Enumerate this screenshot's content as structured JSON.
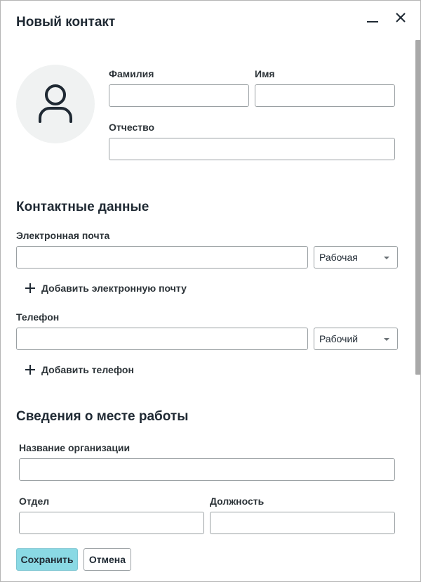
{
  "dialog": {
    "title": "Новый контакт"
  },
  "name": {
    "last_name_label": "Фамилия",
    "first_name_label": "Имя",
    "middle_name_label": "Отчество",
    "last_name_value": "",
    "first_name_value": "",
    "middle_name_value": ""
  },
  "contacts": {
    "section_title": "Контактные данные",
    "email_label": "Электронная почта",
    "email_value": "",
    "email_type": "Рабочая",
    "add_email_label": "Добавить электронную почту",
    "phone_label": "Телефон",
    "phone_value": "",
    "phone_type": "Рабочий",
    "add_phone_label": "Добавить телефон"
  },
  "work": {
    "section_title": "Сведения о месте работы",
    "org_label": "Название организации",
    "org_value": "",
    "department_label": "Отдел",
    "department_value": "",
    "position_label": "Должность",
    "position_value": ""
  },
  "footer": {
    "save_label": "Сохранить",
    "cancel_label": "Отмена"
  },
  "colors": {
    "accent": "#8ad9e4",
    "text": "#1f2933",
    "border": "#9aa0a3",
    "avatar_bg": "#f0f2f2"
  },
  "icons": {
    "minimize": "minimize-icon",
    "close": "close-icon",
    "avatar": "user-icon",
    "add": "plus-icon",
    "dropdown": "chevron-down-icon"
  }
}
